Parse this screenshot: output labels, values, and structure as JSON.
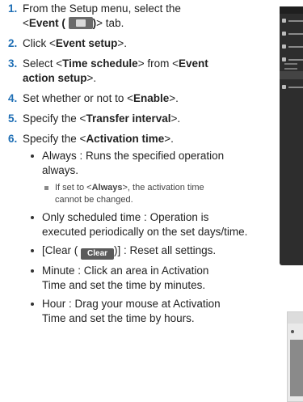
{
  "steps": [
    {
      "num": "1.",
      "parts": {
        "prefix": "From the Setup menu, select the",
        "line2_open": "<",
        "event": "Event (",
        "close": ")",
        "end": "> tab."
      }
    },
    {
      "num": "2.",
      "text_prefix": "Click <",
      "bold": "Event setup",
      "text_suffix": ">."
    },
    {
      "num": "3.",
      "text_prefix": "Select <",
      "bold1": "Time schedule",
      "mid": "> from <",
      "bold2": "Event",
      "line2_bold": "action setup",
      "line2_suffix": ">."
    },
    {
      "num": "4.",
      "text_prefix": "Set whether or not to <",
      "bold": "Enable",
      "text_suffix": ">."
    },
    {
      "num": "5.",
      "text_prefix": "Specify the <",
      "bold": "Transfer interval",
      "text_suffix": ">."
    },
    {
      "num": "6.",
      "text_prefix": "Specify the <",
      "bold": "Activation time",
      "text_suffix": ">."
    }
  ],
  "bullets": {
    "always": {
      "line1": "Always : Runs the specified operation",
      "line2": "always."
    },
    "note": {
      "line1_prefix": "If set to <",
      "line1_bold": "Always",
      "line1_suffix": ">, the activation time",
      "line2": "cannot be changed."
    },
    "scheduled": {
      "line1": "Only scheduled time : Operation is",
      "line2": "executed periodically on the set days/time."
    },
    "clear": {
      "prefix": "[Clear (",
      "button": "Clear",
      "suffix": ")] : Reset all settings."
    },
    "minute": {
      "line1": "Minute : Click an area in Activation",
      "line2": "Time and set the time by minutes."
    },
    "hour": {
      "line1": "Hour : Drag your mouse at Activation",
      "line2": "Time and set the time by hours."
    }
  },
  "icons": {
    "event": "event-tab-icon"
  }
}
